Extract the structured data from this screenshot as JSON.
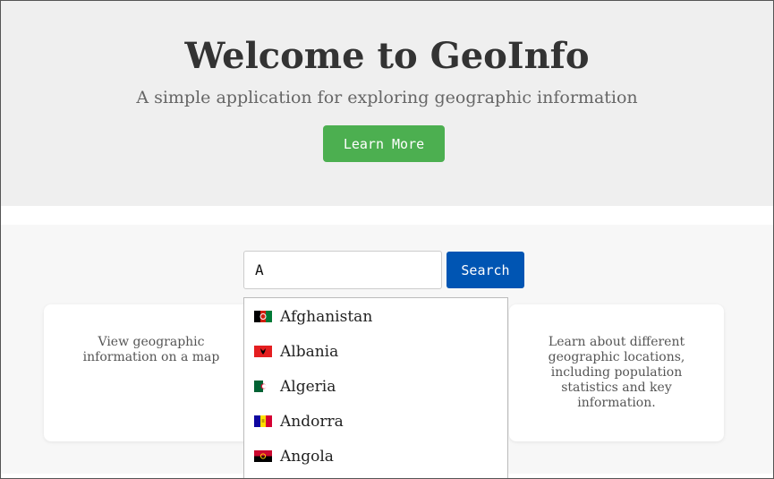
{
  "hero": {
    "title": "Welcome to GeoInfo",
    "subtitle": "A simple application for exploring geographic information",
    "button_label": "Learn More"
  },
  "search": {
    "value": "A",
    "button_label": "Search"
  },
  "cards": {
    "left_text": "View geographic information on a map",
    "right_text": "Learn about different geographic locations, including population statistics and key information."
  },
  "dropdown": {
    "items": [
      {
        "name": "Afghanistan",
        "flag": "afghanistan-flag-icon"
      },
      {
        "name": "Albania",
        "flag": "albania-flag-icon"
      },
      {
        "name": "Algeria",
        "flag": "algeria-flag-icon"
      },
      {
        "name": "Andorra",
        "flag": "andorra-flag-icon"
      },
      {
        "name": "Angola",
        "flag": "angola-flag-icon"
      }
    ]
  },
  "colors": {
    "hero_bg": "#efefef",
    "learn_more": "#4caf50",
    "search_button": "#0055b3",
    "main_bg": "#f7f7f7"
  }
}
